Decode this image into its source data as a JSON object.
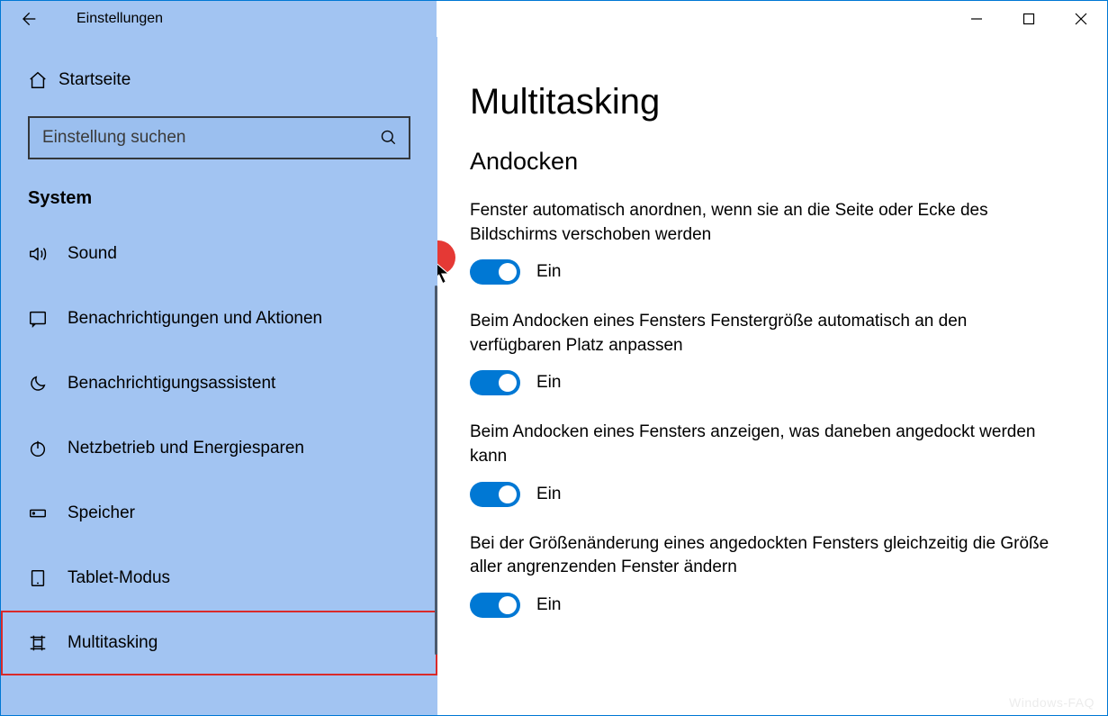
{
  "titlebar": {
    "title": "Einstellungen"
  },
  "sidebar": {
    "home": "Startseite",
    "search_placeholder": "Einstellung suchen",
    "category": "System",
    "items": [
      {
        "label": "Sound"
      },
      {
        "label": "Benachrichtigungen und Aktionen"
      },
      {
        "label": "Benachrichtigungsassistent"
      },
      {
        "label": "Netzbetrieb und Energiesparen"
      },
      {
        "label": "Speicher"
      },
      {
        "label": "Tablet-Modus"
      },
      {
        "label": "Multitasking"
      }
    ]
  },
  "content": {
    "page_title": "Multitasking",
    "section_title": "Andocken",
    "settings": [
      {
        "label": "Fenster automatisch anordnen, wenn sie an die Seite oder Ecke des Bildschirms verschoben werden",
        "state": "Ein"
      },
      {
        "label": "Beim Andocken eines Fensters Fenstergröße automatisch an den verfügbaren Platz anpassen",
        "state": "Ein"
      },
      {
        "label": "Beim Andocken eines Fensters anzeigen, was daneben angedockt werden kann",
        "state": "Ein"
      },
      {
        "label": "Bei der Größenänderung eines angedockten Fensters gleichzeitig die Größe aller angrenzenden Fenster ändern",
        "state": "Ein"
      }
    ]
  },
  "watermark": "Windows-FAQ"
}
